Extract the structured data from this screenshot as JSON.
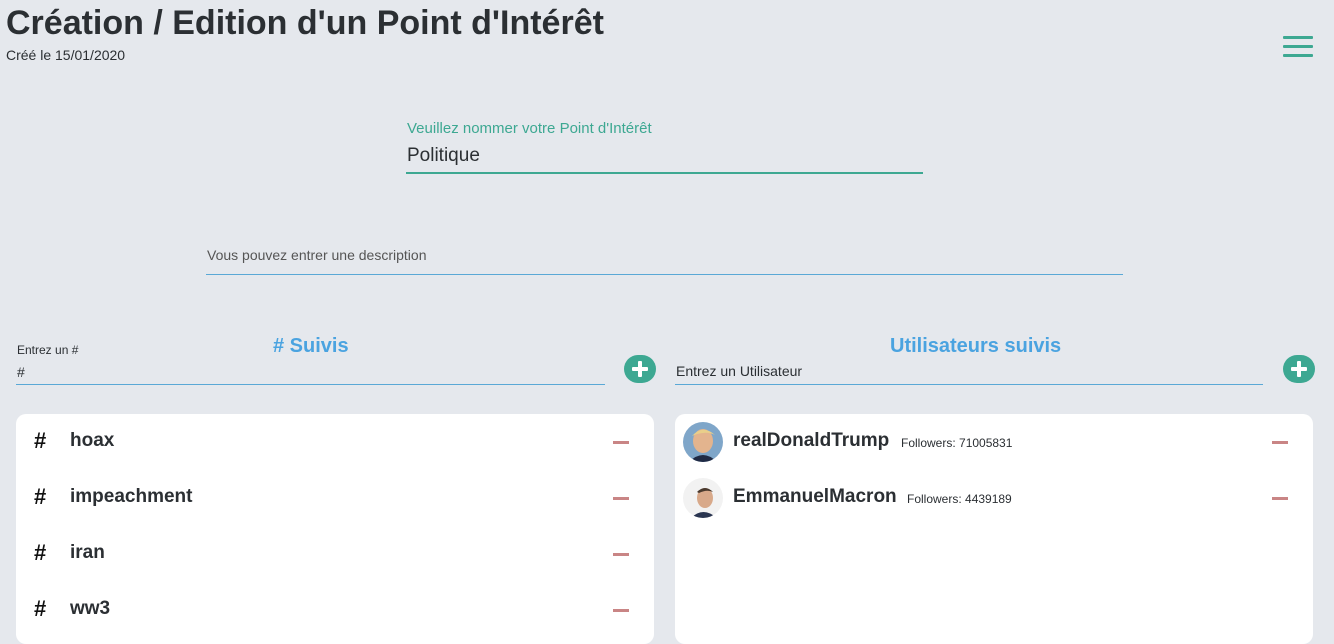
{
  "header": {
    "title": "Création / Edition d'un Point d'Intérêt",
    "created": "Créé le 15/01/2020"
  },
  "form": {
    "name_label": "Veuillez nommer votre Point d'Intérêt",
    "name_value": "Politique",
    "description_placeholder": "Vous pouvez entrer une description"
  },
  "hashtags": {
    "section_title": "# Suivis",
    "input_label": "Entrez un #",
    "input_value": "#",
    "items": [
      {
        "symbol": "#",
        "tag": "hoax"
      },
      {
        "symbol": "#",
        "tag": "impeachment"
      },
      {
        "symbol": "#",
        "tag": "iran"
      },
      {
        "symbol": "#",
        "tag": "ww3"
      }
    ]
  },
  "users": {
    "section_title": "Utilisateurs suivis",
    "input_placeholder": "Entrez un Utilisateur",
    "items": [
      {
        "name": "realDonaldTrump",
        "followers": "Followers: 71005831"
      },
      {
        "name": "EmmanuelMacron",
        "followers": "Followers: 4439189"
      }
    ]
  },
  "colors": {
    "accent": "#3da892",
    "blue": "#4aa3e0",
    "remove": "#c98585",
    "background": "#e5e8ed"
  },
  "icons": {
    "menu": "hamburger-menu-icon",
    "add": "plus-circle-icon",
    "remove": "minus-icon"
  }
}
